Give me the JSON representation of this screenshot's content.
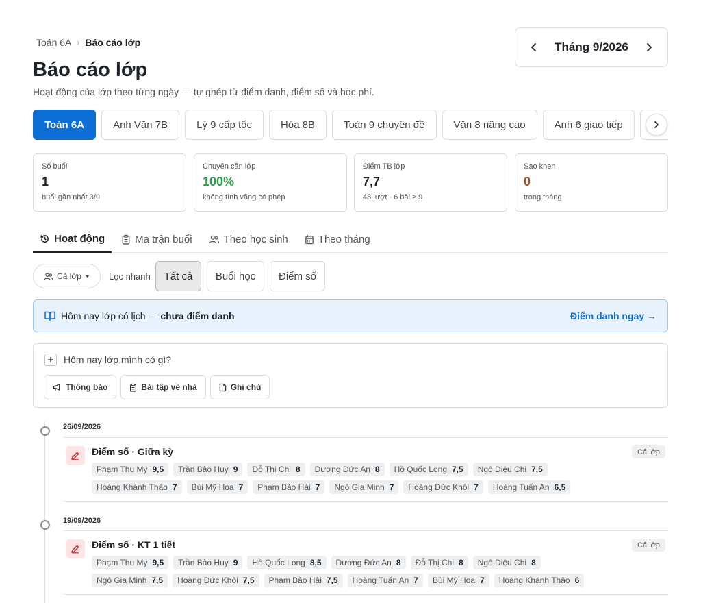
{
  "breadcrumb": {
    "parent": "Toán 6A",
    "separator": "›",
    "current": "Báo cáo lớp"
  },
  "page": {
    "title": "Báo cáo lớp",
    "subtitle": "Hoạt động của lớp theo từng ngày — tự ghép từ điểm danh, điểm số và học phí."
  },
  "month": {
    "label": "Tháng 9/2026"
  },
  "class_tabs": [
    "Toán 6A",
    "Anh Văn 7B",
    "Lý 9 cấp tốc",
    "Hóa 8B",
    "Toán 9 chuyên đề",
    "Văn 8 nâng cao",
    "Anh 6 giao tiếp",
    ""
  ],
  "stats": [
    {
      "label": "Số buổi",
      "value": "1",
      "sub": "buổi gần nhất 3/9",
      "color": "#1f2328"
    },
    {
      "label": "Chuyên cần lớp",
      "value": "100%",
      "sub": "không tính vắng có phép",
      "color": "#2e9e4f"
    },
    {
      "label": "Điểm TB lớp",
      "value": "7,7",
      "sub": "48 lượt · 6 bài ≥ 9",
      "color": "#1f2328"
    },
    {
      "label": "Sao khen",
      "value": "0",
      "sub": "trong tháng",
      "color": "#a0522d"
    }
  ],
  "view_tabs": [
    "Hoạt động",
    "Ma trận buổi",
    "Theo học sinh",
    "Theo tháng"
  ],
  "filters": {
    "scope": "Cả lớp",
    "quick_label": "Lọc nhanh",
    "options": [
      "Tất cả",
      "Buổi học",
      "Điểm số"
    ]
  },
  "banner": {
    "text": "Hôm nay lớp có lịch — ",
    "strong": "chưa điểm danh",
    "link": "Điểm danh ngay →"
  },
  "composer": {
    "prompt": "Hôm nay lớp mình có gì?",
    "actions": [
      "Thông báo",
      "Bài tập về nhà",
      "Ghi chú"
    ]
  },
  "timeline": [
    {
      "date": "26/09/2026",
      "title": "Điểm số · Giữa kỳ",
      "scope": "Cả lớp",
      "rows": [
        [
          [
            "Phạm Thu My",
            "9,5"
          ],
          [
            "Trần Bảo Huy",
            "9"
          ],
          [
            "Đỗ Thị Chi",
            "8"
          ],
          [
            "Dương Đức An",
            "8"
          ],
          [
            "Hồ Quốc Long",
            "7,5"
          ],
          [
            "Ngô Diệu Chi",
            "7,5"
          ]
        ],
        [
          [
            "Hoàng Khánh Thảo",
            "7"
          ],
          [
            "Bùi Mỹ Hoa",
            "7"
          ],
          [
            "Phạm Bảo Hải",
            "7"
          ],
          [
            "Ngô Gia Minh",
            "7"
          ],
          [
            "Hoàng Đức Khôi",
            "7"
          ],
          [
            "Hoàng Tuấn An",
            "6,5"
          ]
        ]
      ]
    },
    {
      "date": "19/09/2026",
      "title": "Điểm số · KT 1 tiết",
      "scope": "Cả lớp",
      "rows": [
        [
          [
            "Phạm Thu My",
            "9,5"
          ],
          [
            "Trần Bảo Huy",
            "9"
          ],
          [
            "Hồ Quốc Long",
            "8,5"
          ],
          [
            "Dương Đức An",
            "8"
          ],
          [
            "Đỗ Thị Chi",
            "8"
          ],
          [
            "Ngô Diệu Chi",
            "8"
          ]
        ],
        [
          [
            "Ngô Gia Minh",
            "7,5"
          ],
          [
            "Hoàng Đức Khôi",
            "7,5"
          ],
          [
            "Phạm Bảo Hải",
            "7,5"
          ],
          [
            "Hoàng Tuấn An",
            "7"
          ],
          [
            "Bùi Mỹ Hoa",
            "7"
          ],
          [
            "Hoàng Khánh Thảo",
            "6"
          ]
        ]
      ]
    }
  ]
}
